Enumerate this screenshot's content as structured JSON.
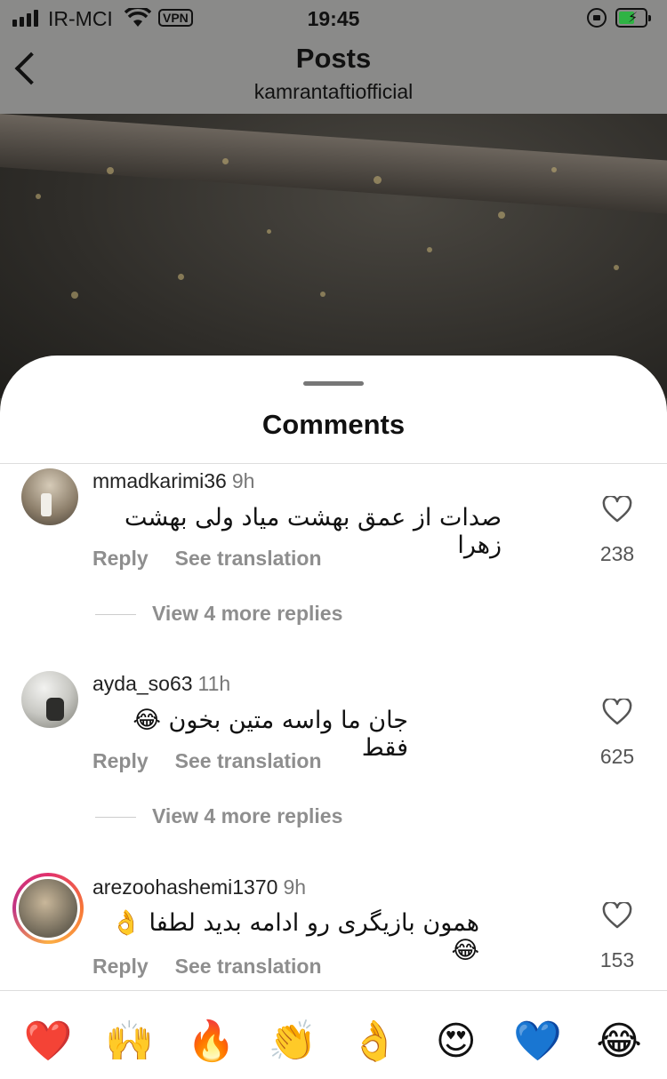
{
  "status_bar": {
    "carrier": "IR-MCI",
    "vpn": "VPN",
    "time": "19:45",
    "battery_level": 0.6,
    "battery_color": "#2fb344"
  },
  "header": {
    "title": "Posts",
    "subtitle": "kamrantaftiofficial",
    "back_icon": "chevron-left-icon"
  },
  "sheet": {
    "title": "Comments"
  },
  "comments": [
    {
      "username": "mmadkarimi36",
      "time": "9h",
      "text": "صدات از عمق بهشت میاد ولی بهشت زهرا",
      "reply_label": "Reply",
      "translate_label": "See translation",
      "likes": "238",
      "more_replies": "View 4 more replies"
    },
    {
      "username": "ayda_so63",
      "time": "11h",
      "text": "جان ما واسه متین بخون 😂فقط",
      "reply_label": "Reply",
      "translate_label": "See translation",
      "likes": "625",
      "more_replies": "View 4 more replies"
    },
    {
      "username": "arezoohashemi1370",
      "time": "9h",
      "text": "همون بازیگری رو ادامه بدید لطفا 👌😂",
      "reply_label": "Reply",
      "translate_label": "See translation",
      "likes": "153"
    }
  ],
  "quick_reactions": [
    "❤️",
    "🙌",
    "🔥",
    "👏",
    "👌",
    "😍",
    "💙",
    "😂"
  ]
}
